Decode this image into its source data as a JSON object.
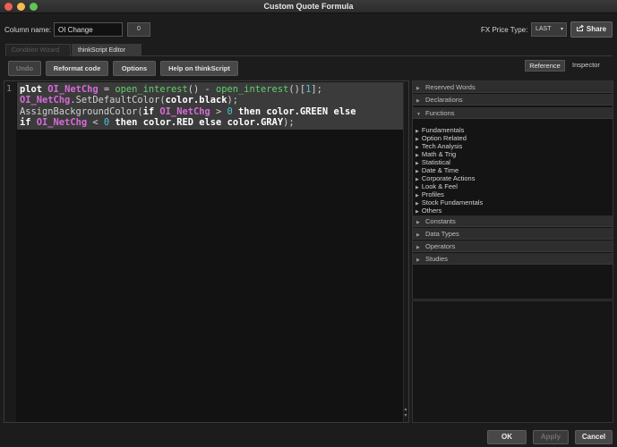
{
  "window": {
    "title": "Custom Quote Formula"
  },
  "column": {
    "label": "Column name:",
    "value": "OI Change",
    "count_button": "0"
  },
  "fx": {
    "label": "FX Price Type:",
    "selected": "LAST",
    "share_label": "Share"
  },
  "tabs": [
    {
      "label": "Condition Wizard",
      "active": false
    },
    {
      "label": "thinkScript Editor",
      "active": true
    }
  ],
  "toolbar": {
    "undo": "Undo",
    "reformat": "Reformat code",
    "options": "Options",
    "help": "Help on thinkScript"
  },
  "side_toggle": {
    "reference": "Reference",
    "inspector": "Inspector"
  },
  "editor": {
    "line_number": "1",
    "lines": [
      "plot OI_NetChg = open_interest() - open_interest()[1];",
      "OI_NetChg.SetDefaultColor(color.black);",
      "AssignBackgroundColor(if OI_NetChg > 0 then color.GREEN else",
      "if OI_NetChg < 0 then color.RED else color.GRAY);"
    ]
  },
  "reference": {
    "sections_top": [
      "Reserved Words",
      "Declarations",
      "Functions"
    ],
    "functions": [
      "Fundamentals",
      "Option Related",
      "Tech Analysis",
      "Math & Trig",
      "Statistical",
      "Date & Time",
      "Corporate Actions",
      "Look & Feel",
      "Profiles",
      "Stock Fundamentals",
      "Others"
    ],
    "sections_bottom": [
      "Constants",
      "Data Types",
      "Operators",
      "Studies"
    ]
  },
  "footer": {
    "ok": "OK",
    "apply": "Apply",
    "cancel": "Cancel"
  },
  "colors": {
    "keyword": "#ffffff",
    "variable": "#d66bd8",
    "function": "#5fd16b",
    "number": "#46c7d6"
  }
}
